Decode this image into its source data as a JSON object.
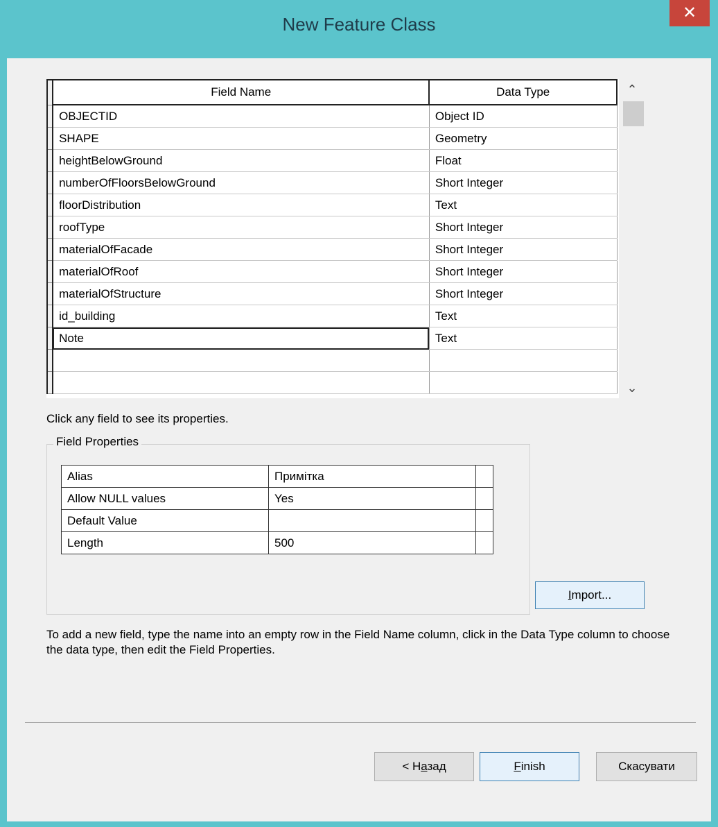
{
  "window": {
    "title": "New Feature Class",
    "close_glyph": "✕"
  },
  "fields_grid": {
    "columns": [
      "Field Name",
      "Data Type"
    ],
    "rows": [
      {
        "name": "OBJECTID",
        "type": "Object ID"
      },
      {
        "name": "SHAPE",
        "type": "Geometry"
      },
      {
        "name": "heightBelowGround",
        "type": "Float"
      },
      {
        "name": "numberOfFloorsBelowGround",
        "type": "Short Integer"
      },
      {
        "name": "floorDistribution",
        "type": "Text"
      },
      {
        "name": "roofType",
        "type": "Short Integer"
      },
      {
        "name": "materialOfFacade",
        "type": "Short Integer"
      },
      {
        "name": "materialOfRoof",
        "type": "Short Integer"
      },
      {
        "name": "materialOfStructure",
        "type": "Short Integer"
      },
      {
        "name": "id_building",
        "type": "Text"
      },
      {
        "name": "Note",
        "type": "Text"
      },
      {
        "name": "",
        "type": ""
      },
      {
        "name": "",
        "type": ""
      }
    ]
  },
  "hint": "Click any field to see its properties.",
  "field_properties": {
    "label": "Field Properties",
    "rows": [
      {
        "name": "Alias",
        "value": "Примітка"
      },
      {
        "name": "Allow NULL values",
        "value": "Yes"
      },
      {
        "name": "Default Value",
        "value": ""
      },
      {
        "name": "Length",
        "value": "500"
      }
    ]
  },
  "import_button": {
    "accel": "I",
    "rest": "mport..."
  },
  "instructions": "To add a new field, type the name into an empty row in the Field Name column, click in the Data Type column to choose the data type, then edit the Field Properties.",
  "footer": {
    "back": {
      "pre": "< Н",
      "accel": "а",
      "post": "зад"
    },
    "finish": {
      "accel": "F",
      "post": "inish"
    },
    "cancel": "Скасувати"
  }
}
